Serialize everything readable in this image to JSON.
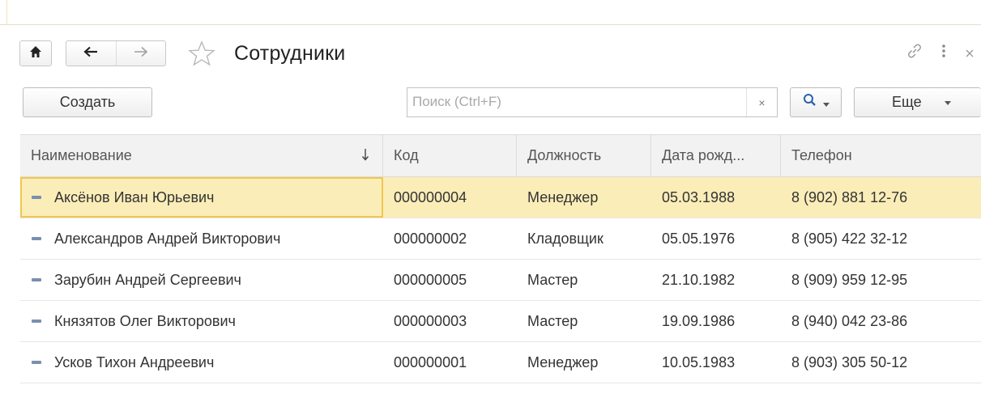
{
  "header": {
    "title": "Сотрудники",
    "icons": [
      "home-icon",
      "back-arrow-icon",
      "forward-arrow-icon",
      "star-icon",
      "link-icon",
      "more-vertical-icon",
      "close-icon"
    ]
  },
  "toolbar": {
    "create_label": "Создать",
    "search_placeholder": "Поиск (Ctrl+F)",
    "search_value": "",
    "clear_label": "×",
    "more_label": "Еще"
  },
  "table": {
    "columns": [
      "Наименование",
      "Код",
      "Должность",
      "Дата рожд...",
      "Телефон"
    ],
    "sorted_column": "Наименование",
    "rows": [
      [
        "Аксёнов Иван Юрьевич",
        "000000004",
        "Менеджер",
        "05.03.1988",
        "8 (902) 881 12-76"
      ],
      [
        "Александров Андрей Викторович",
        "000000002",
        "Кладовщик",
        "05.05.1976",
        "8 (905) 422 32-12"
      ],
      [
        "Зарубин Андрей Сергеевич",
        "000000005",
        "Мастер",
        "21.10.1982",
        "8 (909) 959 12-95"
      ],
      [
        "Князятов Олег Викторович",
        "000000003",
        "Мастер",
        "19.09.1986",
        "8 (940) 042 23-86"
      ],
      [
        "Усков Тихон Андреевич",
        "000000001",
        "Менеджер",
        "10.05.1983",
        "8 (903) 305 50-12"
      ]
    ],
    "selected_row": 0
  },
  "colors": {
    "selected_row_bg": "#fbedb8",
    "selected_cell_border": "#f0c650",
    "header_bg": "#f2f2f2",
    "search_icon": "#2b5fb3"
  }
}
